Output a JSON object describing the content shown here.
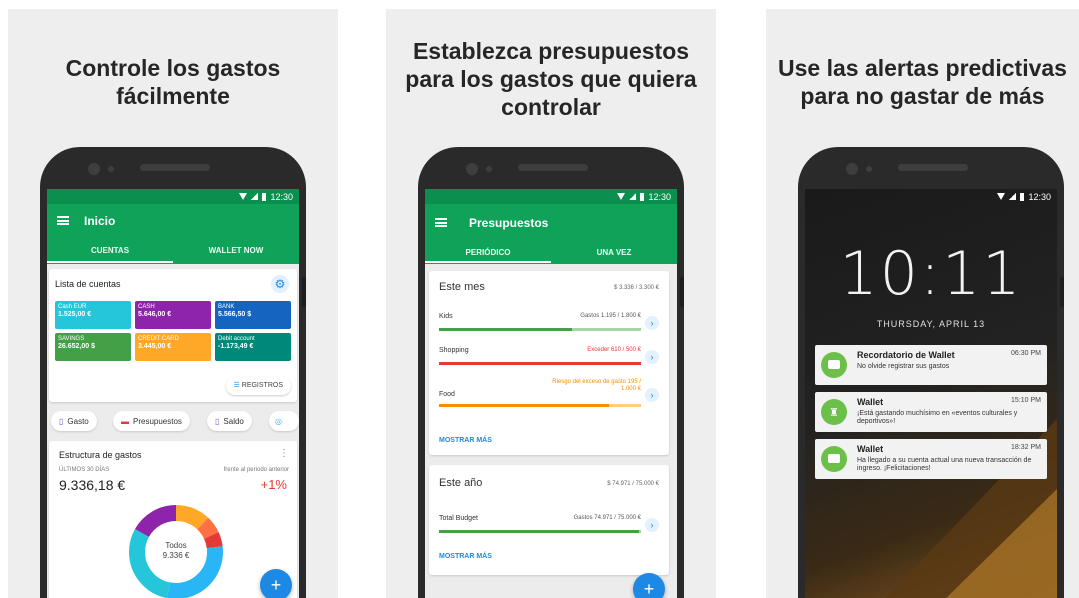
{
  "panels": {
    "first": {
      "headline_line1": "Controle los gastos",
      "headline_line2": "fácilmente",
      "status_time": "12:30",
      "app_title": "Inicio",
      "tabs": [
        "CUENTAS",
        "WALLET NOW"
      ],
      "accounts_title": "Lista de cuentas",
      "accounts": [
        {
          "name": "Cash EUR",
          "value": "1.525,00 €",
          "color": "#26c6da"
        },
        {
          "name": "CASH",
          "value": "5.646,00 €",
          "color": "#8e24aa"
        },
        {
          "name": "BANK",
          "value": "5.566,50 $",
          "color": "#1565c0"
        },
        {
          "name": "SAVINGS",
          "value": "26.652,00 $",
          "color": "#43a047"
        },
        {
          "name": "CREDIT CARD",
          "value": "3.445,00 €",
          "color": "#ffa726"
        },
        {
          "name": "Debit account",
          "value": "-1.173,49 €",
          "color": "#00897b"
        }
      ],
      "records_button": "REGISTROS",
      "chips": [
        "Gasto",
        "Presupuestos",
        "Saldo"
      ],
      "structure_title": "Estructura de gastos",
      "period_label": "ÚLTIMOS 30 DÍAS",
      "compare_label": "frente al periodo anterior",
      "total": "9.336,18 €",
      "change": "+1%",
      "donut_center_label": "Todos",
      "donut_center_value": "9.336 €",
      "fab": "+"
    },
    "second": {
      "headline_line1": "Establezca presupuestos",
      "headline_line2": "para los gastos que quiera",
      "headline_line3": "controlar",
      "status_time": "12:30",
      "app_title": "Presupuestos",
      "tabs": [
        "PERIÓDICO",
        "UNA VEZ"
      ],
      "month_card": {
        "title": "Este mes",
        "total": "$ 3.336 / 3.300 €",
        "rows": [
          {
            "label": "Kids",
            "amount": "Gastos 1.195 / 1.800 €",
            "fill": 0.66,
            "color": "#43a047",
            "tail_color": "#a5d6a7"
          },
          {
            "label": "Shopping",
            "amount": "Exceder 610 / 500 €",
            "fill": 1.0,
            "color": "#e53935",
            "tail_color": "#e53935"
          },
          {
            "label": "Food",
            "amount": "Riesgo del exceso de gasto 195 / 1.000 €",
            "fill": 0.84,
            "color": "#fb8c00",
            "tail_color": "#ffcc80"
          }
        ],
        "more": "MOSTRAR MÁS"
      },
      "year_card": {
        "title": "Este año",
        "total": "$ 74.971 / 75.000 €",
        "rows": [
          {
            "label": "Total Budget",
            "amount": "Gastos 74.971 / 75.000 €",
            "fill": 0.99,
            "color": "#43a047",
            "tail_color": "#a5d6a7"
          }
        ],
        "more": "MOSTRAR MÁS"
      },
      "fab": "+"
    },
    "third": {
      "headline_line1": "Use las alertas predictivas",
      "headline_line2": "para no gastar de más",
      "status_time": "12:30",
      "clock": "10:11",
      "date": "THURSDAY, APRIL 13",
      "notifications": [
        {
          "title": "Recordatorio de Wallet",
          "time": "06:30 PM",
          "body": "No olvide registrar sus gastos"
        },
        {
          "title": "Wallet",
          "time": "15:10 PM",
          "body": "¡Está gastando muchísimo en «eventos culturales y deportivos»!"
        },
        {
          "title": "Wallet",
          "time": "18:32 PM",
          "body": "Ha llegado a su cuenta actual una nueva transacción de ingreso. ¡Felicitaciones!"
        }
      ]
    }
  },
  "colors": {
    "green_primary": "#0fa35a",
    "blue_accent": "#1e88e5",
    "positive_red": "#e53935"
  },
  "donut": [
    {
      "share": 0.12,
      "color": "#ffa726"
    },
    {
      "share": 0.06,
      "color": "#ff7043"
    },
    {
      "share": 0.05,
      "color": "#e53935"
    },
    {
      "share": 0.3,
      "color": "#29b6f6"
    },
    {
      "share": 0.3,
      "color": "#26c6da"
    },
    {
      "share": 0.17,
      "color": "#8e24aa"
    }
  ]
}
